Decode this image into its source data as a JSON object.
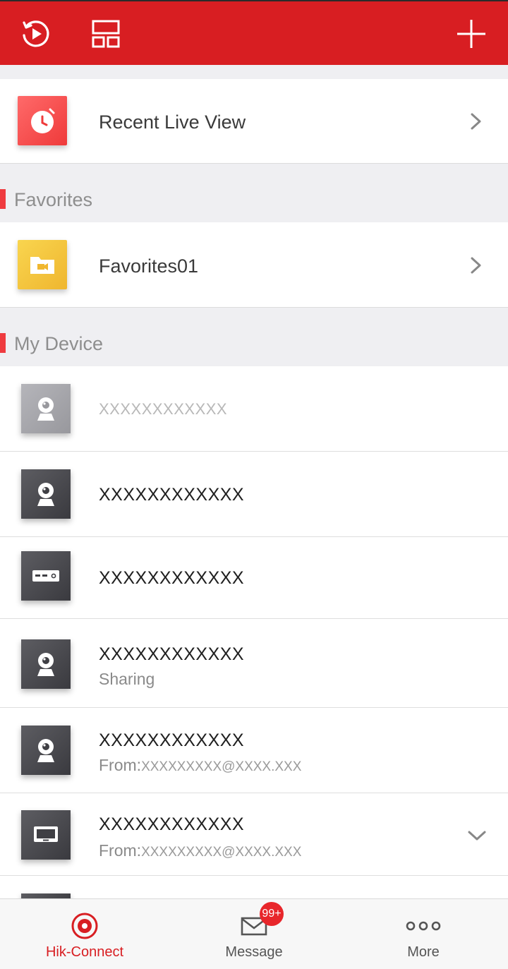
{
  "header": {
    "icons": [
      "playback-history-icon",
      "layout-grid-icon",
      "add-icon"
    ],
    "bg_color": "#d81e22"
  },
  "recent": {
    "label": "Recent Live View",
    "icon": "alarm-clock-icon"
  },
  "favorites_section": {
    "title": "Favorites"
  },
  "favorites": [
    {
      "label": "Favorites01",
      "icon": "folder-camera-icon"
    }
  ],
  "device_section": {
    "title": "My Device"
  },
  "devices": [
    {
      "name": "XXXXXXXXXXXX",
      "icon": "camera-icon",
      "offline": true
    },
    {
      "name": "XXXXXXXXXXXX",
      "icon": "camera-icon"
    },
    {
      "name": "XXXXXXXXXXXX",
      "icon": "nvr-recorder-icon"
    },
    {
      "name": "XXXXXXXXXXXX",
      "icon": "camera-icon",
      "status": "Sharing"
    },
    {
      "name": "XXXXXXXXXXXX",
      "icon": "camera-icon",
      "from_label": "From:",
      "from_email": "XXXXXXXXX@XXXX.XXX"
    },
    {
      "name": "XXXXXXXXXXXX",
      "icon": "monitor-icon",
      "from_label": "From:",
      "from_email": "XXXXXXXXX@XXXX.XXX",
      "expandable": true
    }
  ],
  "nav": {
    "items": [
      {
        "label": "Hik-Connect",
        "icon": "hik-connect-icon",
        "active": true
      },
      {
        "label": "Message",
        "icon": "envelope-icon",
        "badge": "99+"
      },
      {
        "label": "More",
        "icon": "more-dots-icon"
      }
    ],
    "accent": "#d81e22"
  }
}
